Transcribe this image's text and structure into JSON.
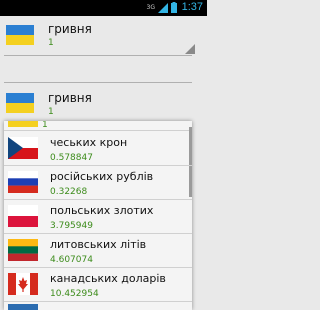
{
  "status_bar": {
    "time": "1:37",
    "network": "3G",
    "icons": [
      "network-3g-icon",
      "signal-icon",
      "battery-icon"
    ]
  },
  "from_currency": {
    "name": "гривня",
    "amount": "1",
    "flag": "ukraine-flag"
  },
  "to_currency": {
    "name": "гривня",
    "amount": "1",
    "flag": "ukraine-flag"
  },
  "dropdown": {
    "partial_top_value": "1",
    "items": [
      {
        "name": "чеських крон",
        "value": "0.578847",
        "flag": "czech-flag"
      },
      {
        "name": "російських рублів",
        "value": "0.32268",
        "flag": "russia-flag"
      },
      {
        "name": "польських злотих",
        "value": "3.795949",
        "flag": "poland-flag"
      },
      {
        "name": "литовських літів",
        "value": "4.607074",
        "flag": "lithuania-flag"
      },
      {
        "name": "канадських доларів",
        "value": "10.452954",
        "flag": "canada-flag"
      }
    ]
  },
  "colors": {
    "value_green": "#3d8c1c",
    "status_accent": "#33b5e5",
    "background": "#e9e9e9"
  }
}
